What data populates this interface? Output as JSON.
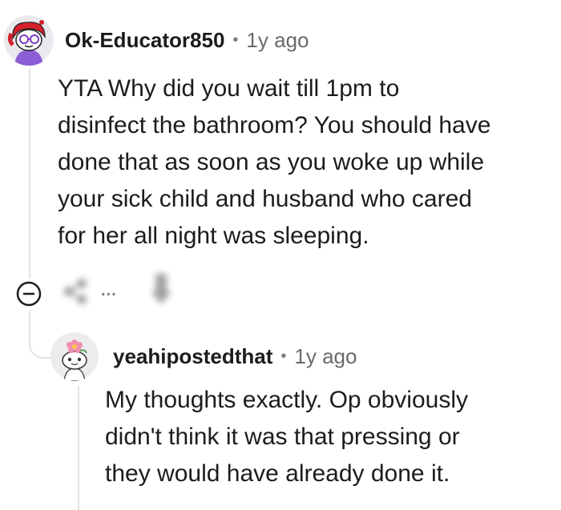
{
  "comment": {
    "username": "Ok-Educator850",
    "separator": "•",
    "time": "1y ago",
    "body_lines": [
      "YTA Why did you wait till 1pm to",
      "disinfect the bathroom? You should have",
      "done that as soon as you woke up while",
      "your sick child and husband who cared",
      "for her all night was sleeping."
    ],
    "avatar_icon": "snoo-avatar-red-hair-icon"
  },
  "actions": {
    "collapse_icon": "collapse-minus-icon",
    "share_icon": "share-icon",
    "more_label": "...",
    "vote_icon": "downvote-icon"
  },
  "reply": {
    "username": "yeahipostedthat",
    "separator": "•",
    "time": "1y ago",
    "body_lines": [
      "My thoughts exactly. Op obviously",
      "didn't think it was that pressing or",
      "they would have already done it."
    ],
    "avatar_icon": "snoo-avatar-flower-icon"
  },
  "colors": {
    "text": "#1c1c1c",
    "muted": "#6a6a6a",
    "thread_line": "#e3e3e3",
    "avatar_red": "#d3202a",
    "avatar_purple": "#8b5fd6"
  }
}
